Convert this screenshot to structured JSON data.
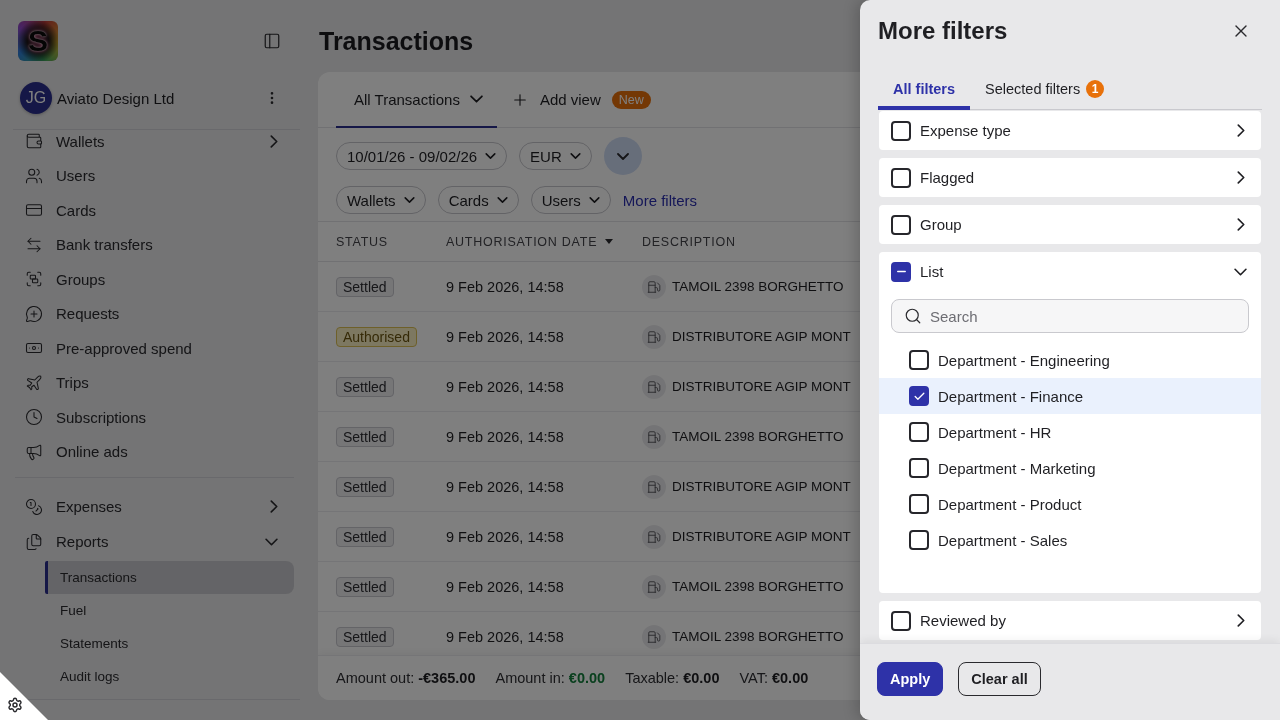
{
  "sidebar": {
    "logo": {
      "letter": "S"
    },
    "account": {
      "initials": "JG",
      "name": "Aviato Design Ltd"
    },
    "nav_groups": [
      {
        "items": [
          {
            "label": "Wallets",
            "expanded": false
          },
          {
            "label": "Users"
          },
          {
            "label": "Cards"
          },
          {
            "label": "Bank transfers"
          },
          {
            "label": "Groups"
          },
          {
            "label": "Requests"
          },
          {
            "label": "Pre-approved spend"
          },
          {
            "label": "Trips"
          },
          {
            "label": "Subscriptions"
          },
          {
            "label": "Online ads"
          }
        ]
      },
      {
        "items": [
          {
            "label": "Expenses",
            "expanded": false
          },
          {
            "label": "Reports",
            "expanded": true,
            "children": [
              {
                "label": "Transactions",
                "selected": true
              },
              {
                "label": "Fuel",
                "selected": false
              },
              {
                "label": "Statements",
                "selected": false
              },
              {
                "label": "Audit logs",
                "selected": false
              }
            ]
          }
        ]
      }
    ]
  },
  "page_title": "Transactions",
  "views": {
    "tabs": [
      {
        "label": "All Transactions",
        "selected": true
      }
    ],
    "add_view": {
      "label": "Add view",
      "badge": "New"
    }
  },
  "filters": {
    "row_1": [
      "10/01/26 - 09/02/26",
      "EUR"
    ],
    "row_2": [
      "Wallets",
      "Cards",
      "Users"
    ],
    "more_filters": "More filters"
  },
  "table": {
    "columns": [
      {
        "label": "STATUS",
        "sorted": false
      },
      {
        "label": "AUTHORISATION DATE",
        "sorted": true
      },
      {
        "label": "DESCRIPTION",
        "sorted": false
      }
    ],
    "rows": [
      {
        "status": {
          "label": "Settled",
          "kind": "settled"
        },
        "date": "9 Feb 2026, 14:58",
        "description": "TAMOIL 2398 BORGHETTO"
      },
      {
        "status": {
          "label": "Authorised",
          "kind": "authorised"
        },
        "date": "9 Feb 2026, 14:58",
        "description": "DISTRIBUTORE AGIP MONT"
      },
      {
        "status": {
          "label": "Settled",
          "kind": "settled"
        },
        "date": "9 Feb 2026, 14:58",
        "description": "DISTRIBUTORE AGIP MONT"
      },
      {
        "status": {
          "label": "Settled",
          "kind": "settled"
        },
        "date": "9 Feb 2026, 14:58",
        "description": "TAMOIL 2398 BORGHETTO"
      },
      {
        "status": {
          "label": "Settled",
          "kind": "settled"
        },
        "date": "9 Feb 2026, 14:58",
        "description": "DISTRIBUTORE AGIP MONT"
      },
      {
        "status": {
          "label": "Settled",
          "kind": "settled"
        },
        "date": "9 Feb 2026, 14:58",
        "description": "DISTRIBUTORE AGIP MONT"
      },
      {
        "status": {
          "label": "Settled",
          "kind": "settled"
        },
        "date": "9 Feb 2026, 14:58",
        "description": "TAMOIL 2398 BORGHETTO"
      },
      {
        "status": {
          "label": "Settled",
          "kind": "settled"
        },
        "date": "9 Feb 2026, 14:58",
        "description": "TAMOIL 2398 BORGHETTO"
      }
    ]
  },
  "totals": [
    {
      "label": "Amount out:",
      "value": "-€365.00",
      "kind": "neutral"
    },
    {
      "label": "Amount in:",
      "value": "€0.00",
      "kind": "positive"
    },
    {
      "label": "Taxable:",
      "value": "€0.00",
      "kind": "neutral"
    },
    {
      "label": "VAT:",
      "value": "€0.00",
      "kind": "neutral"
    }
  ],
  "filters_panel": {
    "title": "More filters",
    "tabs": [
      {
        "label": "All filters",
        "selected": true
      },
      {
        "label": "Selected filters",
        "selected": false,
        "badge": "1"
      }
    ],
    "sections": [
      {
        "label": "Expense type",
        "checked": false,
        "indeterminate": false,
        "expanded": false
      },
      {
        "label": "Flagged",
        "checked": false,
        "indeterminate": false,
        "expanded": false
      },
      {
        "label": "Group",
        "checked": false,
        "indeterminate": false,
        "expanded": false
      },
      {
        "label": "List",
        "checked": false,
        "indeterminate": true,
        "expanded": true,
        "search": {
          "placeholder": "Search"
        },
        "options": [
          {
            "label": "Department - Engineering",
            "checked": false,
            "highlighted": false
          },
          {
            "label": "Department - Finance",
            "checked": true,
            "highlighted": true
          },
          {
            "label": "Department - HR",
            "checked": false,
            "highlighted": false
          },
          {
            "label": "Department - Marketing",
            "checked": false,
            "highlighted": false
          },
          {
            "label": "Department - Product",
            "checked": false,
            "highlighted": false
          },
          {
            "label": "Department - Sales",
            "checked": false,
            "highlighted": false
          }
        ]
      },
      {
        "label": "Reviewed by",
        "checked": false,
        "indeterminate": false,
        "expanded": false
      }
    ],
    "actions": [
      {
        "label": "Apply",
        "kind": "primary"
      },
      {
        "label": "Clear all",
        "kind": "secondary"
      }
    ]
  }
}
